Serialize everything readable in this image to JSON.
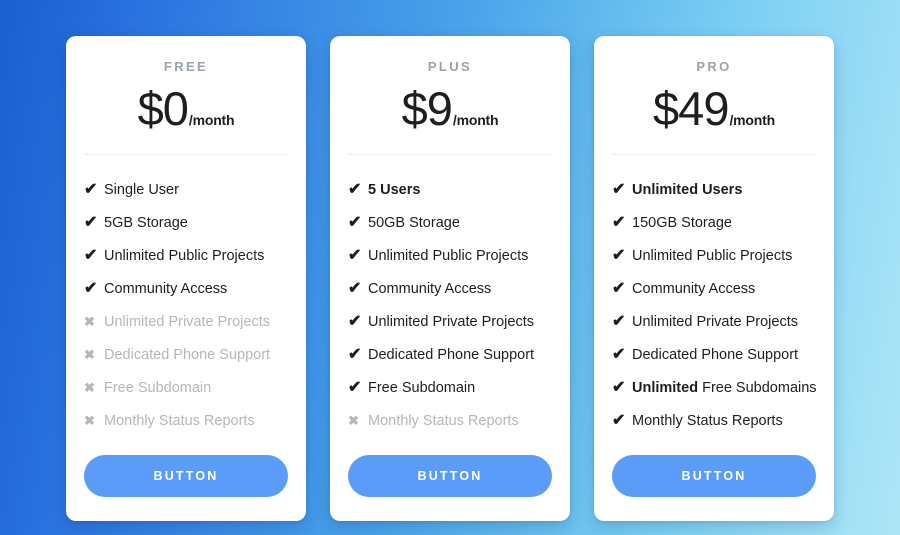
{
  "background": {
    "gradient_from": "#1a5fd0",
    "gradient_mid": "#49a3ea",
    "gradient_to": "#aee6f7"
  },
  "theme": {
    "accent": "#5b9cf8",
    "text": "#1c1e21",
    "muted": "#b3b7bc",
    "label": "#9aa3ab",
    "card_bg": "#ffffff",
    "divider": "#eceef0"
  },
  "icons": {
    "check": "✔",
    "cross": "✖"
  },
  "plans": [
    {
      "name": "FREE",
      "price": "$0",
      "period": "/month",
      "button_label": "BUTTON",
      "features": [
        {
          "text": "Single User",
          "included": true,
          "bold": false
        },
        {
          "text": "5GB Storage",
          "included": true,
          "bold": false
        },
        {
          "text": "Unlimited Public Projects",
          "included": true,
          "bold": false
        },
        {
          "text": "Community Access",
          "included": true,
          "bold": false
        },
        {
          "text": "Unlimited Private Projects",
          "included": false,
          "bold": false
        },
        {
          "text": "Dedicated Phone Support",
          "included": false,
          "bold": false
        },
        {
          "text": "Free Subdomain",
          "included": false,
          "bold": false
        },
        {
          "text": "Monthly Status Reports",
          "included": false,
          "bold": false
        }
      ]
    },
    {
      "name": "PLUS",
      "price": "$9",
      "period": "/month",
      "button_label": "BUTTON",
      "features": [
        {
          "text": "5 Users",
          "included": true,
          "bold": true
        },
        {
          "text": "50GB Storage",
          "included": true,
          "bold": false
        },
        {
          "text": "Unlimited Public Projects",
          "included": true,
          "bold": false
        },
        {
          "text": "Community Access",
          "included": true,
          "bold": false
        },
        {
          "text": "Unlimited Private Projects",
          "included": true,
          "bold": false
        },
        {
          "text": "Dedicated Phone Support",
          "included": true,
          "bold": false
        },
        {
          "text": "Free Subdomain",
          "included": true,
          "bold": false
        },
        {
          "text": "Monthly Status Reports",
          "included": false,
          "bold": false
        }
      ]
    },
    {
      "name": "PRO",
      "price": "$49",
      "period": "/month",
      "button_label": "BUTTON",
      "features": [
        {
          "text": "Unlimited Users",
          "included": true,
          "bold": true
        },
        {
          "text": "150GB Storage",
          "included": true,
          "bold": false
        },
        {
          "text": "Unlimited Public Projects",
          "included": true,
          "bold": false
        },
        {
          "text": "Community Access",
          "included": true,
          "bold": false
        },
        {
          "text": "Unlimited Private Projects",
          "included": true,
          "bold": false
        },
        {
          "text": "Dedicated Phone Support",
          "included": true,
          "bold": false
        },
        {
          "text": "Unlimited Free Subdomains",
          "included": true,
          "bold": false,
          "emphasis": "Unlimited"
        },
        {
          "text": "Monthly Status Reports",
          "included": true,
          "bold": false
        }
      ]
    }
  ]
}
